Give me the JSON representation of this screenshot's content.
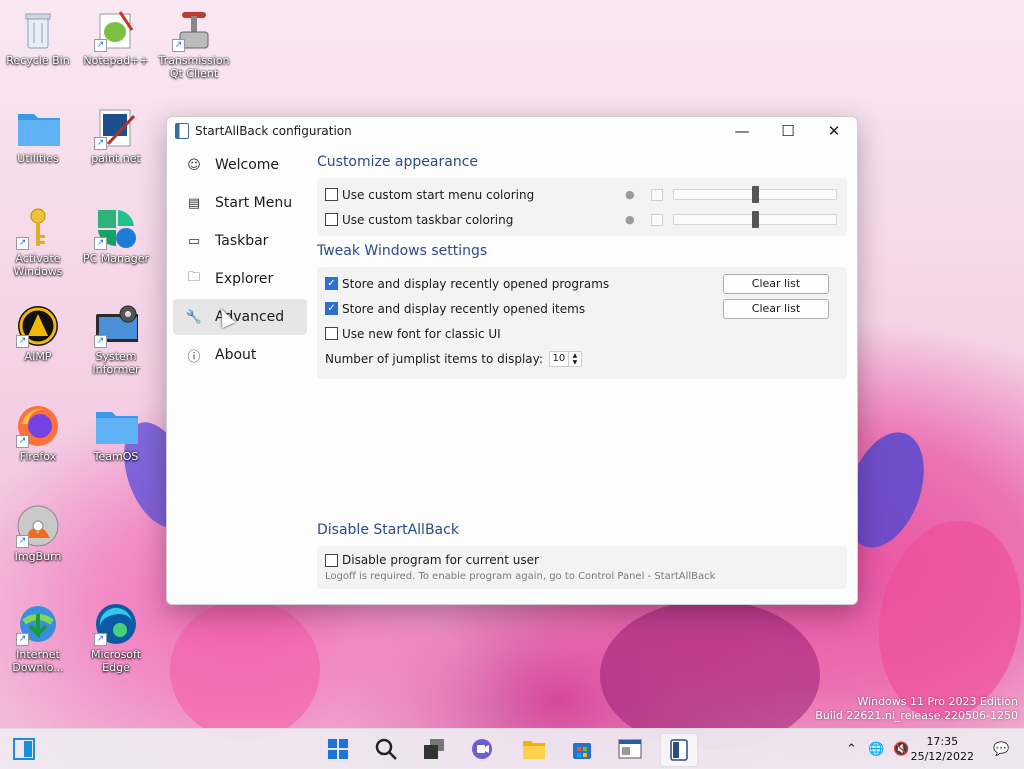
{
  "desktop": {
    "icons": [
      {
        "label": "Recycle Bin"
      },
      {
        "label": "Notepad++"
      },
      {
        "label": "Transmission Qt Client"
      },
      {
        "label": "Utilities"
      },
      {
        "label": "paint.net"
      },
      {
        "label": "Activate Windows"
      },
      {
        "label": "PC Manager"
      },
      {
        "label": "AIMP"
      },
      {
        "label": "System Informer"
      },
      {
        "label": "Firefox"
      },
      {
        "label": "TeamOS"
      },
      {
        "label": "ImgBurn"
      },
      {
        "label": "Internet Downlo..."
      },
      {
        "label": "Microsoft Edge"
      }
    ]
  },
  "window": {
    "title": "StartAllBack configuration",
    "sidebar": [
      {
        "label": "Welcome",
        "icon": "smile-icon"
      },
      {
        "label": "Start Menu",
        "icon": "start-menu-icon"
      },
      {
        "label": "Taskbar",
        "icon": "taskbar-icon"
      },
      {
        "label": "Explorer",
        "icon": "folder-icon"
      },
      {
        "label": "Advanced",
        "icon": "wrench-icon",
        "active": true
      },
      {
        "label": "About",
        "icon": "info-icon"
      }
    ],
    "appearance": {
      "title": "Customize appearance",
      "start_coloring": "Use custom start menu coloring",
      "taskbar_coloring": "Use custom taskbar coloring"
    },
    "tweaks": {
      "title": "Tweak Windows settings",
      "recent_programs": "Store and display recently opened programs",
      "recent_items": "Store and display recently opened items",
      "classic_font": "Use new font for classic UI",
      "jumplist_label": "Number of jumplist items to display:",
      "jumplist_value": "10",
      "clear_list": "Clear list"
    },
    "disable": {
      "title": "Disable StartAllBack",
      "label": "Disable program for current user",
      "note": "Logoff is required. To enable program again, go to Control Panel - StartAllBack"
    }
  },
  "watermark": {
    "line1": "Windows 11 Pro 2023 Edition",
    "line2": "Build 22621.ni_release.220506-1250"
  },
  "clock": {
    "time": "17:35",
    "date": "25/12/2022"
  }
}
